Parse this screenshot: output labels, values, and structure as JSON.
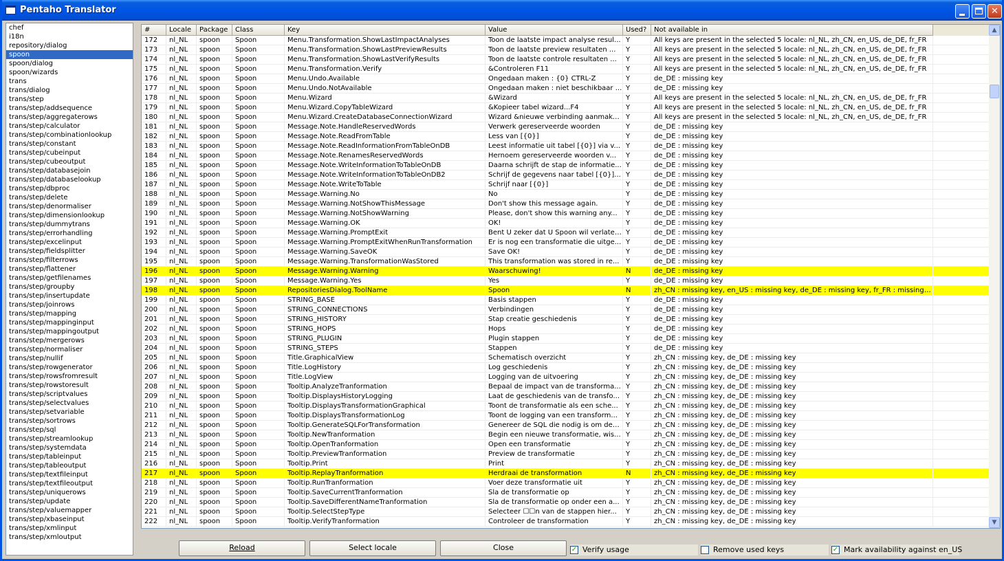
{
  "window": {
    "title": "Pentaho Translator"
  },
  "tree": {
    "selected_index": 3,
    "items": [
      "chef",
      "i18n",
      "repository/dialog",
      "spoon",
      "spoon/dialog",
      "spoon/wizards",
      "trans",
      "trans/dialog",
      "trans/step",
      "trans/step/addsequence",
      "trans/step/aggregaterows",
      "trans/step/calculator",
      "trans/step/combinationlookup",
      "trans/step/constant",
      "trans/step/cubeinput",
      "trans/step/cubeoutput",
      "trans/step/databasejoin",
      "trans/step/databaselookup",
      "trans/step/dbproc",
      "trans/step/delete",
      "trans/step/denormaliser",
      "trans/step/dimensionlookup",
      "trans/step/dummytrans",
      "trans/step/errorhandling",
      "trans/step/excelinput",
      "trans/step/fieldsplitter",
      "trans/step/filterrows",
      "trans/step/flattener",
      "trans/step/getfilenames",
      "trans/step/groupby",
      "trans/step/insertupdate",
      "trans/step/joinrows",
      "trans/step/mapping",
      "trans/step/mappinginput",
      "trans/step/mappingoutput",
      "trans/step/mergerows",
      "trans/step/normaliser",
      "trans/step/nullif",
      "trans/step/rowgenerator",
      "trans/step/rowsfromresult",
      "trans/step/rowstoresult",
      "trans/step/scriptvalues",
      "trans/step/selectvalues",
      "trans/step/setvariable",
      "trans/step/sortrows",
      "trans/step/sql",
      "trans/step/streamlookup",
      "trans/step/systemdata",
      "trans/step/tableinput",
      "trans/step/tableoutput",
      "trans/step/textfileinput",
      "trans/step/textfileoutput",
      "trans/step/uniquerows",
      "trans/step/update",
      "trans/step/valuemapper",
      "trans/step/xbaseinput",
      "trans/step/xmlinput",
      "trans/step/xmloutput"
    ]
  },
  "table": {
    "columns": [
      "#",
      "Locale",
      "Package",
      "Class",
      "Key",
      "Value",
      "Used?",
      "Not available in"
    ],
    "rows": [
      [
        "172",
        "nl_NL",
        "spoon",
        "Spoon",
        "Menu.Transformation.ShowLastImpactAnalyses",
        "Toon de laatste impact analyse resul...",
        "Y",
        "All keys are present in the selected 5 locale: nl_NL, zh_CN, en_US, de_DE, fr_FR"
      ],
      [
        "173",
        "nl_NL",
        "spoon",
        "Spoon",
        "Menu.Transformation.ShowLastPreviewResults",
        "Toon de laatste preview resultaten ...",
        "Y",
        "All keys are present in the selected 5 locale: nl_NL, zh_CN, en_US, de_DE, fr_FR"
      ],
      [
        "174",
        "nl_NL",
        "spoon",
        "Spoon",
        "Menu.Transformation.ShowLastVerifyResults",
        "Toon de laatste controle resultaten ...",
        "Y",
        "All keys are present in the selected 5 locale: nl_NL, zh_CN, en_US, de_DE, fr_FR"
      ],
      [
        "175",
        "nl_NL",
        "spoon",
        "Spoon",
        "Menu.Transformation.Verify",
        "&Controleren F11",
        "Y",
        "All keys are present in the selected 5 locale: nl_NL, zh_CN, en_US, de_DE, fr_FR"
      ],
      [
        "176",
        "nl_NL",
        "spoon",
        "Spoon",
        "Menu.Undo.Available",
        "Ongedaan maken : {0} CTRL-Z",
        "Y",
        "de_DE : missing key"
      ],
      [
        "177",
        "nl_NL",
        "spoon",
        "Spoon",
        "Menu.Undo.NotAvailable",
        "Ongedaan maken : niet beschikbaar ...",
        "Y",
        "de_DE : missing key"
      ],
      [
        "178",
        "nl_NL",
        "spoon",
        "Spoon",
        "Menu.Wizard",
        "&Wizard",
        "Y",
        "All keys are present in the selected 5 locale: nl_NL, zh_CN, en_US, de_DE, fr_FR"
      ],
      [
        "179",
        "nl_NL",
        "spoon",
        "Spoon",
        "Menu.Wizard.CopyTableWizard",
        "&Kopieer tabel wizard...F4",
        "Y",
        "All keys are present in the selected 5 locale: nl_NL, zh_CN, en_US, de_DE, fr_FR"
      ],
      [
        "180",
        "nl_NL",
        "spoon",
        "Spoon",
        "Menu.Wizard.CreateDatabaseConnectionWizard",
        "Wizard &nieuwe verbinding aanmake...",
        "Y",
        "All keys are present in the selected 5 locale: nl_NL, zh_CN, en_US, de_DE, fr_FR"
      ],
      [
        "181",
        "nl_NL",
        "spoon",
        "Spoon",
        "Message.Note.HandleReservedWords",
        "Verwerk gereserveerde woorden",
        "Y",
        "de_DE : missing key"
      ],
      [
        "182",
        "nl_NL",
        "spoon",
        "Spoon",
        "Message.Note.ReadFromTable",
        "Less van [{0}]",
        "Y",
        "de_DE : missing key"
      ],
      [
        "183",
        "nl_NL",
        "spoon",
        "Spoon",
        "Message.Note.ReadInformationFromTableOnDB",
        "Leest informatie uit tabel [{0}] via v...",
        "Y",
        "de_DE : missing key"
      ],
      [
        "184",
        "nl_NL",
        "spoon",
        "Spoon",
        "Message.Note.RenamesReservedWords",
        "Hernoem gereserveerde woorden v...",
        "Y",
        "de_DE : missing key"
      ],
      [
        "185",
        "nl_NL",
        "spoon",
        "Spoon",
        "Message.Note.WriteInformationToTableOnDB",
        "Daarna schrijft de stap de informatie...",
        "Y",
        "de_DE : missing key"
      ],
      [
        "186",
        "nl_NL",
        "spoon",
        "Spoon",
        "Message.Note.WriteInformationToTableOnDB2",
        "Schrijf de gegevens naar tabel [{0}]...",
        "Y",
        "de_DE : missing key"
      ],
      [
        "187",
        "nl_NL",
        "spoon",
        "Spoon",
        "Message.Note.WriteToTable",
        "Schrijf naar [{0}]",
        "Y",
        "de_DE : missing key"
      ],
      [
        "188",
        "nl_NL",
        "spoon",
        "Spoon",
        "Message.Warning.No",
        "No",
        "Y",
        "de_DE : missing key"
      ],
      [
        "189",
        "nl_NL",
        "spoon",
        "Spoon",
        "Message.Warning.NotShowThisMessage",
        "Don't show this message again.",
        "Y",
        "de_DE : missing key"
      ],
      [
        "190",
        "nl_NL",
        "spoon",
        "Spoon",
        "Message.Warning.NotShowWarning",
        "Please, don't show this warning any...",
        "Y",
        "de_DE : missing key"
      ],
      [
        "191",
        "nl_NL",
        "spoon",
        "Spoon",
        "Message.Warning.OK",
        "OK!",
        "Y",
        "de_DE : missing key"
      ],
      [
        "192",
        "nl_NL",
        "spoon",
        "Spoon",
        "Message.Warning.PromptExit",
        "Bent U zeker dat U Spoon wil verlaten?",
        "Y",
        "de_DE : missing key"
      ],
      [
        "193",
        "nl_NL",
        "spoon",
        "Spoon",
        "Message.Warning.PromptExitWhenRunTransformation",
        "Er is nog een transformatie die uitge...",
        "Y",
        "de_DE : missing key"
      ],
      [
        "194",
        "nl_NL",
        "spoon",
        "Spoon",
        "Message.Warning.SaveOK",
        "Save OK!",
        "Y",
        "de_DE : missing key"
      ],
      [
        "195",
        "nl_NL",
        "spoon",
        "Spoon",
        "Message.Warning.TransformationWasStored",
        "This transformation was stored in re...",
        "Y",
        "de_DE : missing key"
      ],
      [
        "196",
        "nl_NL",
        "spoon",
        "Spoon",
        "Message.Warning.Warning",
        "Waarschuwing!",
        "N",
        "de_DE : missing key"
      ],
      [
        "197",
        "nl_NL",
        "spoon",
        "Spoon",
        "Message.Warning.Yes",
        "Yes",
        "Y",
        "de_DE : missing key"
      ],
      [
        "198",
        "nl_NL",
        "spoon",
        "Spoon",
        "RepositoriesDialog.ToolName",
        "Spoon",
        "N",
        "zh_CN : missing key, en_US : missing key, de_DE : missing key, fr_FR : missing key"
      ],
      [
        "199",
        "nl_NL",
        "spoon",
        "Spoon",
        "STRING_BASE",
        "Basis stappen",
        "Y",
        "de_DE : missing key"
      ],
      [
        "200",
        "nl_NL",
        "spoon",
        "Spoon",
        "STRING_CONNECTIONS",
        "Verbindingen",
        "Y",
        "de_DE : missing key"
      ],
      [
        "201",
        "nl_NL",
        "spoon",
        "Spoon",
        "STRING_HISTORY",
        "Stap creatie geschiedenis",
        "Y",
        "de_DE : missing key"
      ],
      [
        "202",
        "nl_NL",
        "spoon",
        "Spoon",
        "STRING_HOPS",
        "Hops",
        "Y",
        "de_DE : missing key"
      ],
      [
        "203",
        "nl_NL",
        "spoon",
        "Spoon",
        "STRING_PLUGIN",
        "Plugin stappen",
        "Y",
        "de_DE : missing key"
      ],
      [
        "204",
        "nl_NL",
        "spoon",
        "Spoon",
        "STRING_STEPS",
        "Stappen",
        "Y",
        "de_DE : missing key"
      ],
      [
        "205",
        "nl_NL",
        "spoon",
        "Spoon",
        "Title.GraphicalView",
        "Schematisch overzicht",
        "Y",
        "zh_CN : missing key, de_DE : missing key"
      ],
      [
        "206",
        "nl_NL",
        "spoon",
        "Spoon",
        "Title.LogHistory",
        "Log geschiedenis",
        "Y",
        "zh_CN : missing key, de_DE : missing key"
      ],
      [
        "207",
        "nl_NL",
        "spoon",
        "Spoon",
        "Title.LogView",
        "Logging van de uitvoering",
        "Y",
        "zh_CN : missing key, de_DE : missing key"
      ],
      [
        "208",
        "nl_NL",
        "spoon",
        "Spoon",
        "Tooltip.AnalyzeTranformation",
        "Bepaal de impact van de transforma...",
        "Y",
        "zh_CN : missing key, de_DE : missing key"
      ],
      [
        "209",
        "nl_NL",
        "spoon",
        "Spoon",
        "Tooltip.DisplaysHistoryLogging",
        "Laat de geschiedenis van de transfo...",
        "Y",
        "zh_CN : missing key, de_DE : missing key"
      ],
      [
        "210",
        "nl_NL",
        "spoon",
        "Spoon",
        "Tooltip.DisplaysTransformationGraphical",
        "Toont de transformatie als een sche...",
        "Y",
        "zh_CN : missing key, de_DE : missing key"
      ],
      [
        "211",
        "nl_NL",
        "spoon",
        "Spoon",
        "Tooltip.DisplaysTransformationLog",
        "Toont de logging van een transform...",
        "Y",
        "zh_CN : missing key, de_DE : missing key"
      ],
      [
        "212",
        "nl_NL",
        "spoon",
        "Spoon",
        "Tooltip.GenerateSQLForTransformation",
        "Genereer de SQL die nodig is om dez...",
        "Y",
        "zh_CN : missing key, de_DE : missing key"
      ],
      [
        "213",
        "nl_NL",
        "spoon",
        "Spoon",
        "Tooltip.NewTranformation",
        "Begin een nieuwe transformatie, wis...",
        "Y",
        "zh_CN : missing key, de_DE : missing key"
      ],
      [
        "214",
        "nl_NL",
        "spoon",
        "Spoon",
        "Tooltip.OpenTranformation",
        "Open een transformatie",
        "Y",
        "zh_CN : missing key, de_DE : missing key"
      ],
      [
        "215",
        "nl_NL",
        "spoon",
        "Spoon",
        "Tooltip.PreviewTranformation",
        "Preview de transformatie",
        "Y",
        "zh_CN : missing key, de_DE : missing key"
      ],
      [
        "216",
        "nl_NL",
        "spoon",
        "Spoon",
        "Tooltip.Print",
        "Print",
        "Y",
        "zh_CN : missing key, de_DE : missing key"
      ],
      [
        "217",
        "nl_NL",
        "spoon",
        "Spoon",
        "Tooltip.ReplayTranformation",
        "Herdraai de transformation",
        "N",
        "zh_CN : missing key, de_DE : missing key"
      ],
      [
        "218",
        "nl_NL",
        "spoon",
        "Spoon",
        "Tooltip.RunTranformation",
        "Voer deze transformatie uit",
        "Y",
        "zh_CN : missing key, de_DE : missing key"
      ],
      [
        "219",
        "nl_NL",
        "spoon",
        "Spoon",
        "Tooltip.SaveCurrentTranformation",
        "Sla de transformatie op",
        "Y",
        "zh_CN : missing key, de_DE : missing key"
      ],
      [
        "220",
        "nl_NL",
        "spoon",
        "Spoon",
        "Tooltip.SaveDifferentNameTranformation",
        "Sla de transformatie op onder een a...",
        "Y",
        "zh_CN : missing key, de_DE : missing key"
      ],
      [
        "221",
        "nl_NL",
        "spoon",
        "Spoon",
        "Tooltip.SelectStepType",
        "Selecteer ☐☐n van de stappen hier...",
        "Y",
        "zh_CN : missing key, de_DE : missing key"
      ],
      [
        "222",
        "nl_NL",
        "spoon",
        "Spoon",
        "Tooltip.VerifyTranformation",
        "Controleer de transformation",
        "Y",
        "zh_CN : missing key, de_DE : missing key"
      ]
    ],
    "highlight_color": "#ffff00"
  },
  "buttons": {
    "reload": "Reload",
    "select_locale": "Select locale",
    "close": "Close"
  },
  "options": {
    "verify_usage": {
      "label": "Verify usage",
      "checked": true
    },
    "remove_used_keys": {
      "label": "Remove used keys",
      "checked": false
    },
    "mark_availability": {
      "label": "Mark availability against en_US",
      "checked": true
    }
  }
}
